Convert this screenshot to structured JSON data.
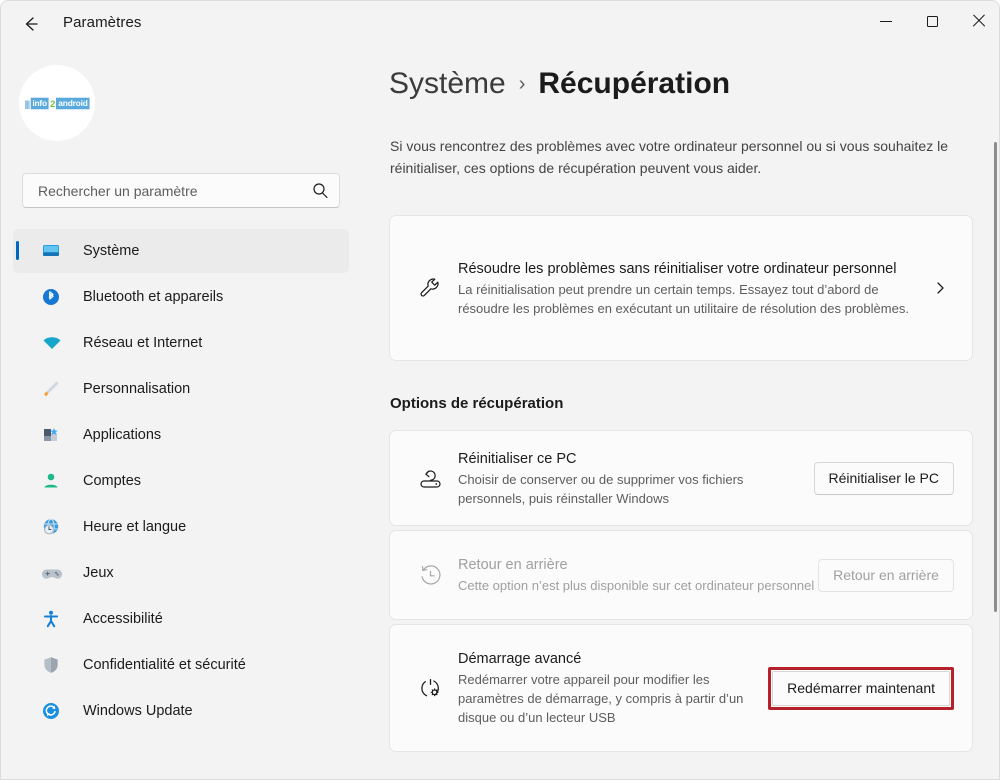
{
  "window": {
    "app_title": "Paramètres",
    "back_icon": "back-arrow-icon",
    "controls": {
      "minimize": "minimize-icon",
      "maximize": "maximize-icon",
      "close": "close-icon"
    }
  },
  "sidebar": {
    "avatar": {
      "watermark_bars": "|||",
      "watermark_info": "info",
      "watermark_two": "2",
      "watermark_android": "android"
    },
    "search": {
      "placeholder": "Rechercher un paramètre",
      "value": "",
      "icon": "search-icon"
    },
    "items": [
      {
        "label": "Système",
        "icon": "monitor-icon",
        "selected": true
      },
      {
        "label": "Bluetooth et appareils",
        "icon": "bluetooth-icon",
        "selected": false
      },
      {
        "label": "Réseau et Internet",
        "icon": "wifi-icon",
        "selected": false
      },
      {
        "label": "Personnalisation",
        "icon": "paintbrush-icon",
        "selected": false
      },
      {
        "label": "Applications",
        "icon": "apps-icon",
        "selected": false
      },
      {
        "label": "Comptes",
        "icon": "person-icon",
        "selected": false
      },
      {
        "label": "Heure et langue",
        "icon": "clock-globe-icon",
        "selected": false
      },
      {
        "label": "Jeux",
        "icon": "gamepad-icon",
        "selected": false
      },
      {
        "label": "Accessibilité",
        "icon": "accessibility-icon",
        "selected": false
      },
      {
        "label": "Confidentialité et sécurité",
        "icon": "shield-icon",
        "selected": false
      },
      {
        "label": "Windows Update",
        "icon": "update-icon",
        "selected": false
      }
    ]
  },
  "main": {
    "breadcrumb": {
      "parent": "Système",
      "separator": "›",
      "current": "Récupération"
    },
    "intro": "Si vous rencontrez des problèmes avec votre ordinateur personnel ou si vous souhaitez le réinitialiser, ces options de récupération peuvent vous aider.",
    "troubleshoot_card": {
      "icon": "wrench-icon",
      "title": "Résoudre les problèmes sans réinitialiser votre ordinateur personnel",
      "description": "La réinitialisation peut prendre un certain temps. Essayez tout d’abord de résoudre les problèmes en exécutant un utilitaire de résolution des problèmes.",
      "chevron": "chevron-right-icon"
    },
    "section_heading": "Options de récupération",
    "cards": [
      {
        "id": "reset",
        "icon": "reset-pc-icon",
        "title": "Réinitialiser ce PC",
        "description": "Choisir de conserver ou de supprimer vos fichiers personnels, puis réinstaller Windows",
        "button_label": "Réinitialiser le PC",
        "disabled": false,
        "highlighted": false
      },
      {
        "id": "rollback",
        "icon": "clock-rewind-icon",
        "title": "Retour en arrière",
        "description": "Cette option n’est plus disponible sur cet ordinateur personnel",
        "button_label": "Retour en arrière",
        "disabled": true,
        "highlighted": false
      },
      {
        "id": "advanced",
        "icon": "power-gear-icon",
        "title": "Démarrage avancé",
        "description": "Redémarrer votre appareil pour modifier les paramètres de démarrage, y compris à partir d’un disque ou d’un lecteur USB",
        "button_label": "Redémarrer maintenant",
        "disabled": false,
        "highlighted": true
      }
    ]
  },
  "annotation": {
    "highlight_color": "#b5202a",
    "target": "Redémarrer maintenant"
  },
  "colors": {
    "page_background": "#f3f3f3",
    "card_background": "#fbfbfb",
    "accent": "#0067c0",
    "text_primary": "#1b1b1b",
    "text_secondary": "#5d5d5d",
    "text_disabled": "#a0a0a0"
  },
  "scrollbar": {
    "visible": true
  }
}
